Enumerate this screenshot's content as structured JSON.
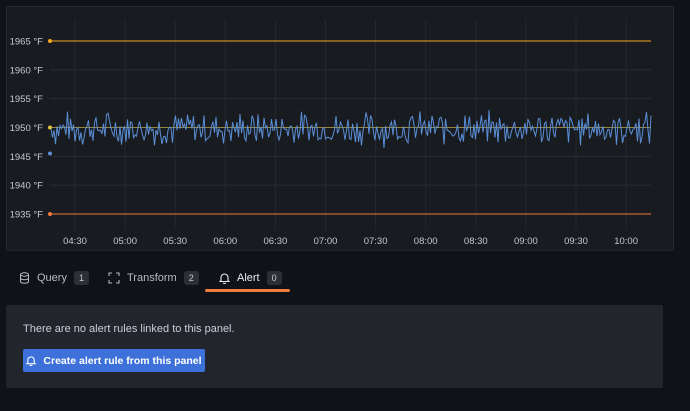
{
  "chart_data": {
    "type": "line",
    "y_ticks": [
      "1965 °F",
      "1960 °F",
      "1955 °F",
      "1950 °F",
      "1945 °F",
      "1940 °F",
      "1935 °F"
    ],
    "x_ticks": [
      "04:30",
      "05:00",
      "05:30",
      "06:00",
      "06:30",
      "07:00",
      "07:30",
      "08:00",
      "08:30",
      "09:00",
      "09:30",
      "10:00"
    ],
    "ylim": [
      1932,
      1968
    ],
    "grid": true,
    "series": [
      {
        "role": "measurement",
        "color": "#5b8ed6",
        "mean": 1949.8,
        "amplitude": 3.4,
        "start_marker": 1945.5
      },
      {
        "role": "upper threshold",
        "color": "#f5a623",
        "value": 1965
      },
      {
        "role": "lower threshold",
        "color": "#f07b3d",
        "value": 1935
      }
    ],
    "reference_line": {
      "value": 1950,
      "color": "#e0c341"
    }
  },
  "tabs": [
    {
      "label": "Query",
      "count": "1",
      "icon": "database-icon"
    },
    {
      "label": "Transform",
      "count": "2",
      "icon": "transform-icon"
    },
    {
      "label": "Alert",
      "count": "0",
      "icon": "bell-icon",
      "active": true
    }
  ],
  "alert": {
    "message": "There are no alert rules linked to this panel.",
    "create_button": "Create alert rule from this panel"
  },
  "colors": {
    "accent_tab": "#f17a3d",
    "button": "#3d71d9",
    "background": "#111217",
    "panel": "#181b1f"
  }
}
